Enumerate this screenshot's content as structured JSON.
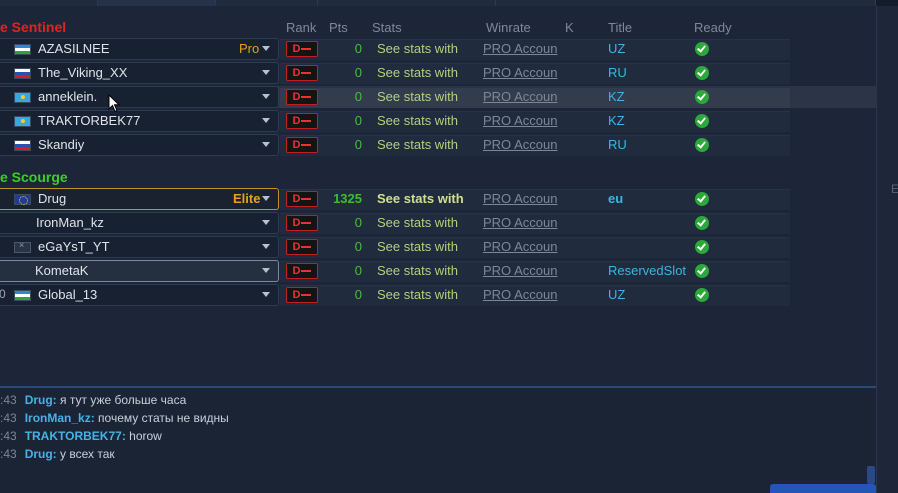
{
  "columns": {
    "rank": "Rank",
    "pts": "Pts",
    "stats": "Stats",
    "winrate": "Winrate",
    "k": "K",
    "title": "Title",
    "ready": "Ready"
  },
  "sentinel": {
    "team_name": "e Sentinel",
    "players": [
      {
        "name": "AZASILNEE",
        "flag": "uz",
        "tier": "Pro",
        "rank": "D",
        "pts": "0",
        "stats": "See stats with",
        "winrate": "PRO Accoun",
        "title": "UZ",
        "ready": true
      },
      {
        "name": "The_Viking_XX",
        "flag": "ru",
        "tier": "",
        "rank": "D",
        "pts": "0",
        "stats": "See stats with",
        "winrate": "PRO Accoun",
        "title": "RU",
        "ready": true
      },
      {
        "name": "anneklein.",
        "flag": "kz",
        "tier": "",
        "rank": "D",
        "pts": "0",
        "stats": "See stats with",
        "winrate": "PRO Accoun",
        "title": "KZ",
        "ready": true
      },
      {
        "name": "TRAKTORBEK77",
        "flag": "kz",
        "tier": "",
        "rank": "D",
        "pts": "0",
        "stats": "See stats with",
        "winrate": "PRO Accoun",
        "title": "KZ",
        "ready": true
      },
      {
        "name": "Skandiy",
        "flag": "ru",
        "tier": "",
        "rank": "D",
        "pts": "0",
        "stats": "See stats with",
        "winrate": "PRO Accoun",
        "title": "RU",
        "ready": true
      }
    ]
  },
  "scourge": {
    "team_name": "e Scourge",
    "players": [
      {
        "name": "Drug",
        "flag": "eu",
        "tier": "Elite",
        "rank": "D",
        "pts": "1325",
        "stats": "See stats with",
        "winrate": "PRO Accoun",
        "title": "eu",
        "ready": true
      },
      {
        "name": "IronMan_kz",
        "flag": "",
        "tier": "",
        "rank": "D",
        "pts": "0",
        "stats": "See stats with",
        "winrate": "PRO Accoun",
        "title": "",
        "ready": true
      },
      {
        "name": "eGaYsT_YT",
        "flag": "none",
        "tier": "",
        "rank": "D",
        "pts": "0",
        "stats": "See stats with",
        "winrate": "PRO Accoun",
        "title": "",
        "ready": true
      },
      {
        "name": "KometaK",
        "flag": "",
        "tier": "",
        "rank": "D",
        "pts": "0",
        "stats": "See stats with",
        "winrate": "PRO Accoun",
        "title": "ReservedSlot",
        "ready": true
      },
      {
        "name": "Global_13",
        "flag": "uz",
        "tier": "",
        "rank": "D",
        "pts": "0",
        "stats": "See stats with",
        "winrate": "PRO Accoun",
        "title": "UZ",
        "ready": true,
        "prefix": "0"
      }
    ]
  },
  "chat": {
    "messages": [
      {
        "time": ":43",
        "author": "Drug:",
        "text": "я тут уже больше часа"
      },
      {
        "time": ":43",
        "author": "IronMan_kz:",
        "text": "почему статы не видны"
      },
      {
        "time": ":43",
        "author": "TRAKTORBEK77:",
        "text": "horow"
      },
      {
        "time": ":43",
        "author": "Drug:",
        "text": "у всех так"
      }
    ]
  },
  "right_panel": {
    "glyph": "E"
  },
  "colors": {
    "sentinel": "#e02424",
    "scourge": "#3bd024",
    "title": "#3ab7e0",
    "tier": "#e7a21b"
  }
}
